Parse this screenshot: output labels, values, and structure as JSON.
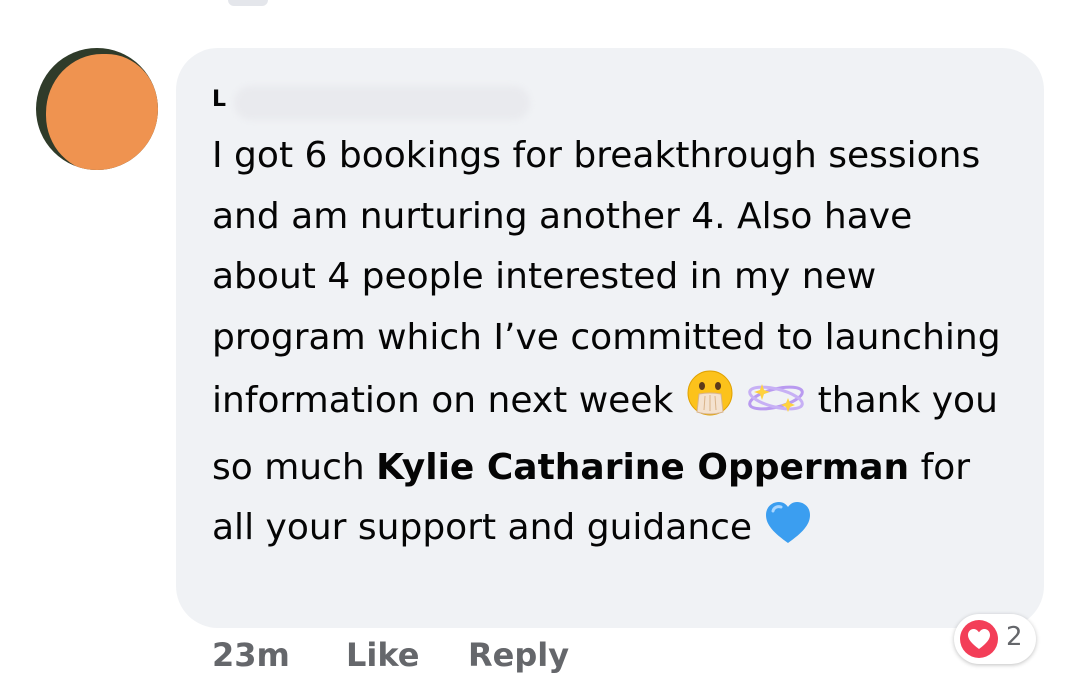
{
  "comment": {
    "author_name": "L",
    "text_segments": {
      "part1": "I got 6 bookings for breakthrough sessions and am nurturing another 4. Also have about 4 people interested in my new program which I’ve committed to launching information on next week",
      "part2": "thank you so much",
      "mention": "Kylie Catharine Opperman",
      "part3": "for all your support and guidance"
    },
    "emojis": [
      "hand-over-mouth-emoji",
      "sparkle-orbit-emoji",
      "blue-heart-emoji"
    ]
  },
  "meta": {
    "time": "23m",
    "like_label": "Like",
    "reply_label": "Reply"
  },
  "reactions": {
    "icon": "heart-icon",
    "count": "2",
    "color": "#f33e58"
  },
  "colors": {
    "bubble": "#f0f2f5",
    "text": "#050505",
    "meta": "#65676b",
    "avatar_overlay": "#ef9350"
  }
}
